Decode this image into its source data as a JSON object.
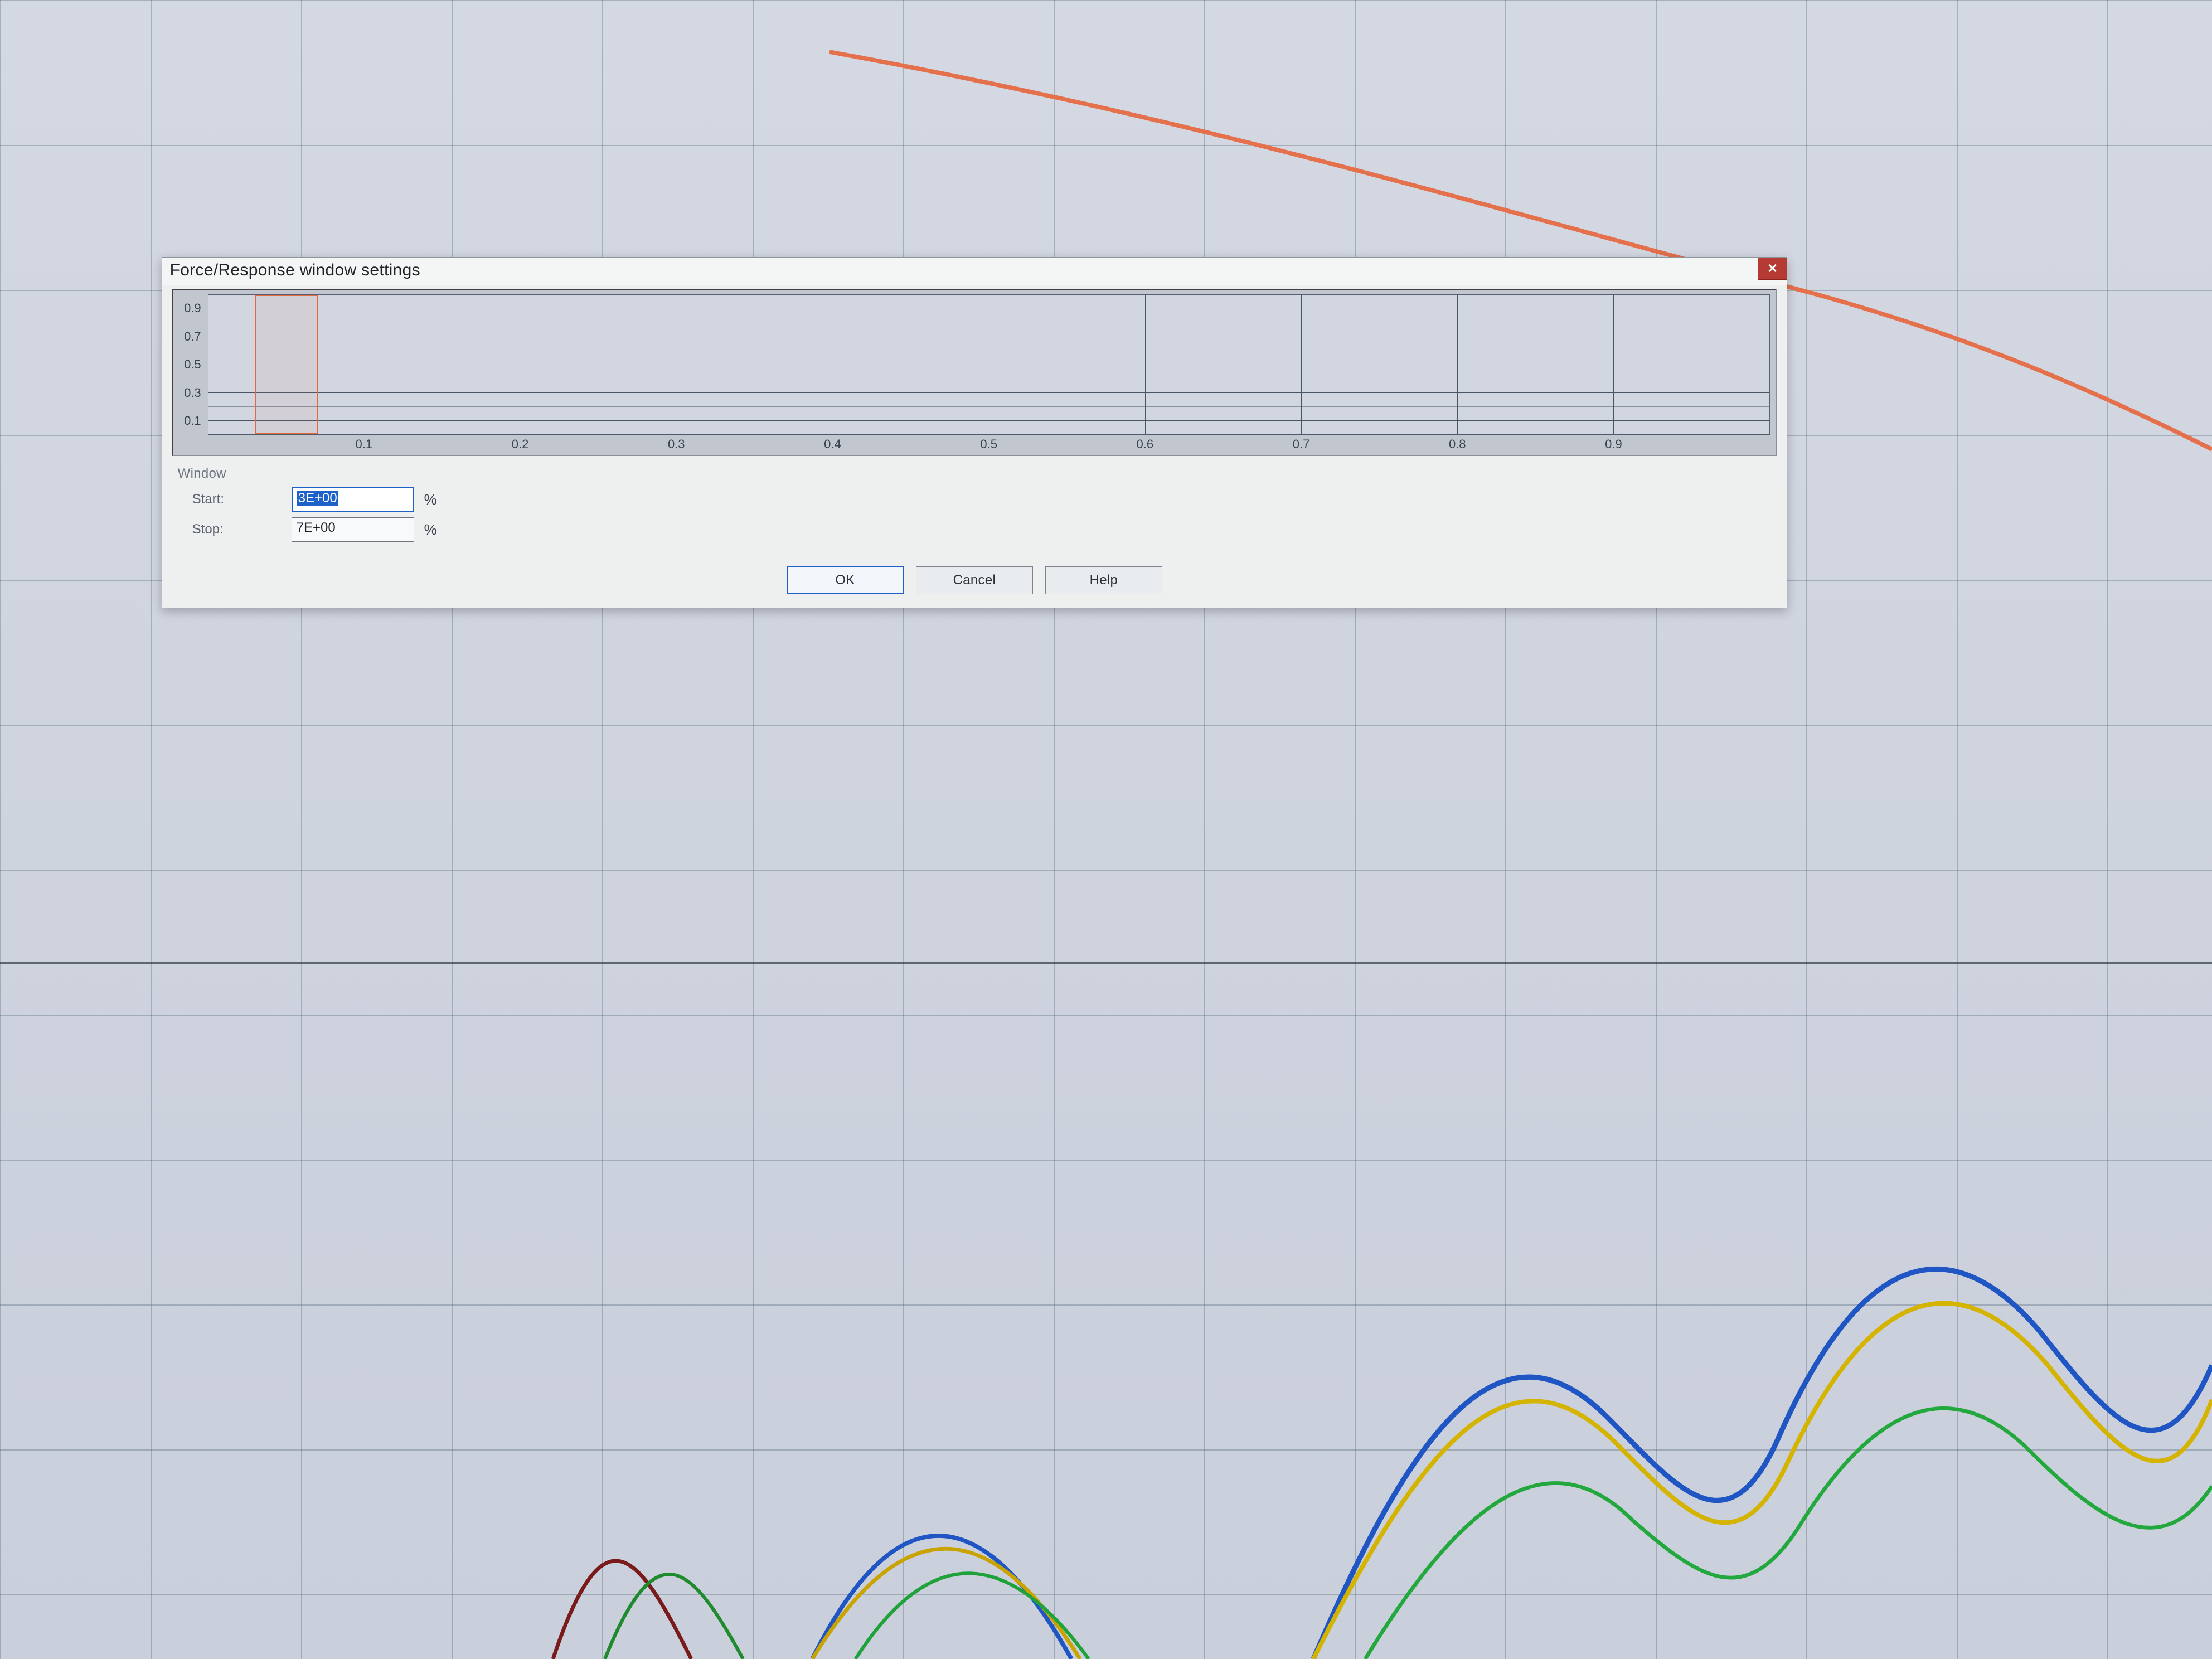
{
  "dialog": {
    "title": "Force/Response window settings",
    "close_glyph": "✕",
    "group_label": "Window",
    "start_label": "Start:",
    "start_value": "3E+00",
    "start_unit": "%",
    "stop_label": "Stop:",
    "stop_value": "7E+00",
    "stop_unit": "%",
    "ok_label": "OK",
    "cancel_label": "Cancel",
    "help_label": "Help"
  },
  "chart_data": {
    "type": "area",
    "title": "",
    "xlabel": "",
    "ylabel": "",
    "xlim": [
      0,
      1
    ],
    "ylim": [
      0,
      1
    ],
    "x_ticks": [
      0.1,
      0.2,
      0.3,
      0.4,
      0.5,
      0.6,
      0.7,
      0.8,
      0.9
    ],
    "y_ticks": [
      0.1,
      0.3,
      0.5,
      0.7,
      0.9
    ],
    "selection": {
      "start_pct": 3,
      "stop_pct": 7
    },
    "series": []
  },
  "axis_labels": {
    "x": [
      "0.1",
      "0.2",
      "0.3",
      "0.4",
      "0.5",
      "0.6",
      "0.7",
      "0.8",
      "0.9"
    ],
    "y": [
      "0.9",
      "0.7",
      "0.5",
      "0.3",
      "0.1"
    ]
  }
}
